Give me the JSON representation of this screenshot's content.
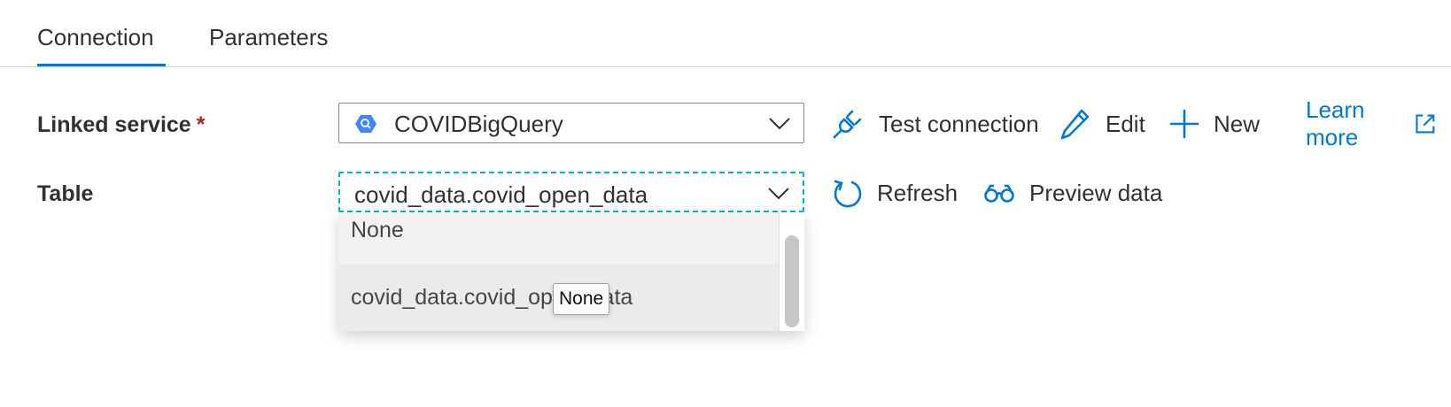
{
  "tabs": [
    {
      "label": "Connection",
      "active": true
    },
    {
      "label": "Parameters",
      "active": false
    }
  ],
  "linked_service": {
    "label": "Linked service",
    "required_marker": "*",
    "value": "COVIDBigQuery",
    "icon": "bigquery-icon"
  },
  "linked_service_actions": {
    "test_connection": "Test connection",
    "edit": "Edit",
    "new": "New",
    "learn_more": "Learn more"
  },
  "table": {
    "label": "Table",
    "value": "covid_data.covid_open_data",
    "options": [
      "None",
      "covid_data.covid_open_data"
    ]
  },
  "table_actions": {
    "refresh": "Refresh",
    "preview": "Preview data"
  },
  "tooltip": "None",
  "colors": {
    "accent": "#0078d4",
    "focus_border": "#00b7c3",
    "required": "#a4262c",
    "bigquery": "#4285f4"
  }
}
